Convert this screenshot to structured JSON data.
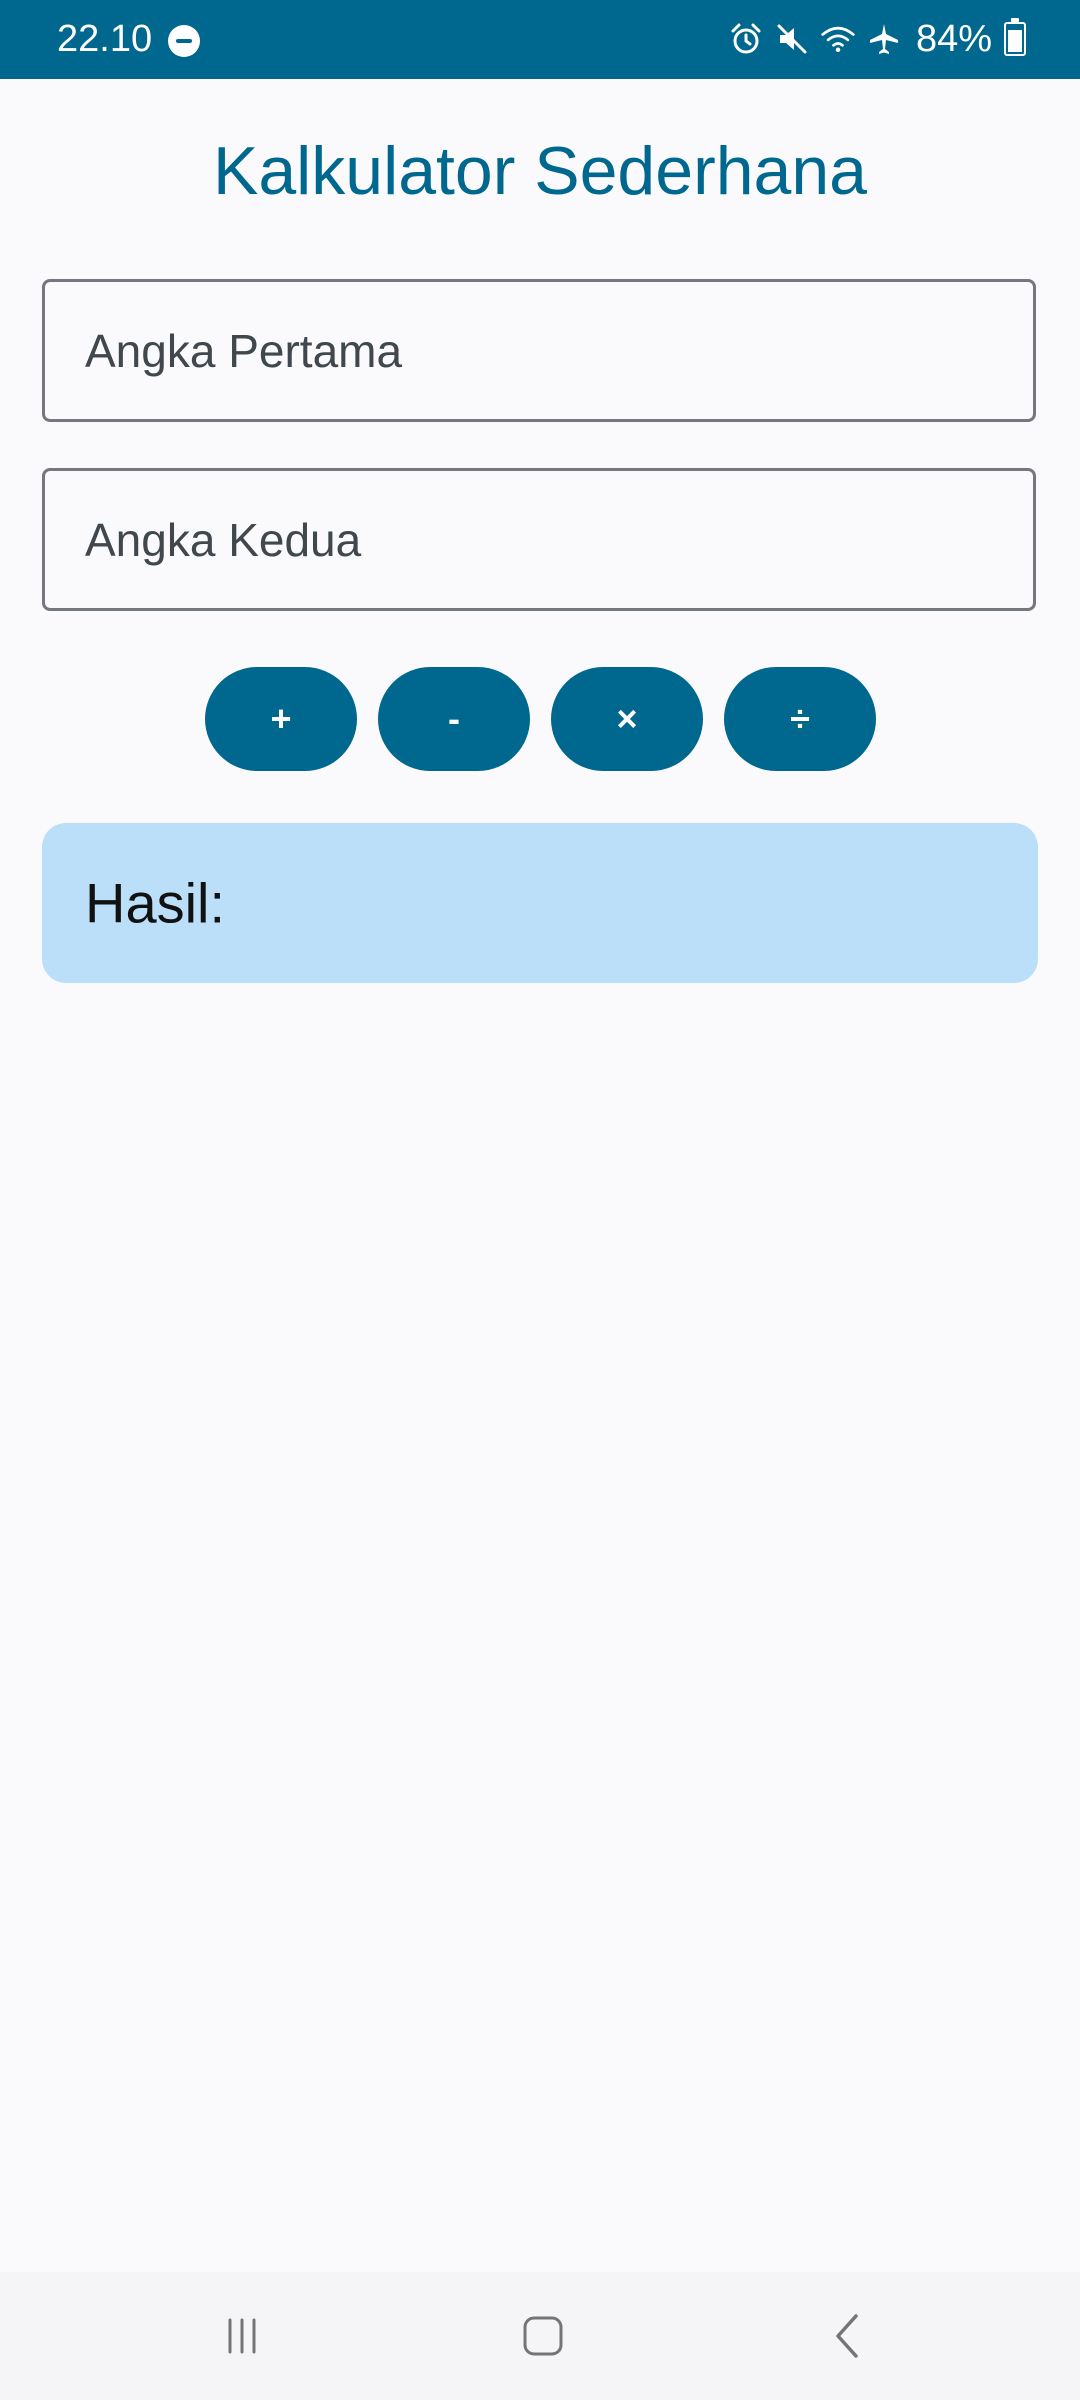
{
  "status_bar": {
    "time": "22.10",
    "battery": "84%",
    "icons": [
      "minus-circle-icon",
      "alarm-icon",
      "mute-icon",
      "wifi-icon",
      "airplane-icon",
      "battery-icon"
    ]
  },
  "app": {
    "title": "Kalkulator Sederhana"
  },
  "inputs": {
    "first": {
      "placeholder": "Angka Pertama",
      "value": ""
    },
    "second": {
      "placeholder": "Angka Kedua",
      "value": ""
    }
  },
  "operations": {
    "add": "+",
    "subtract": "-",
    "multiply": "×",
    "divide": "÷"
  },
  "result": {
    "label": "Hasil:"
  },
  "nav_bar": {
    "icons": [
      "recent-apps-icon",
      "home-icon",
      "back-icon"
    ]
  },
  "colors": {
    "primary": "#00678f",
    "result_bg": "#bbdef9",
    "background": "#fafafc"
  }
}
